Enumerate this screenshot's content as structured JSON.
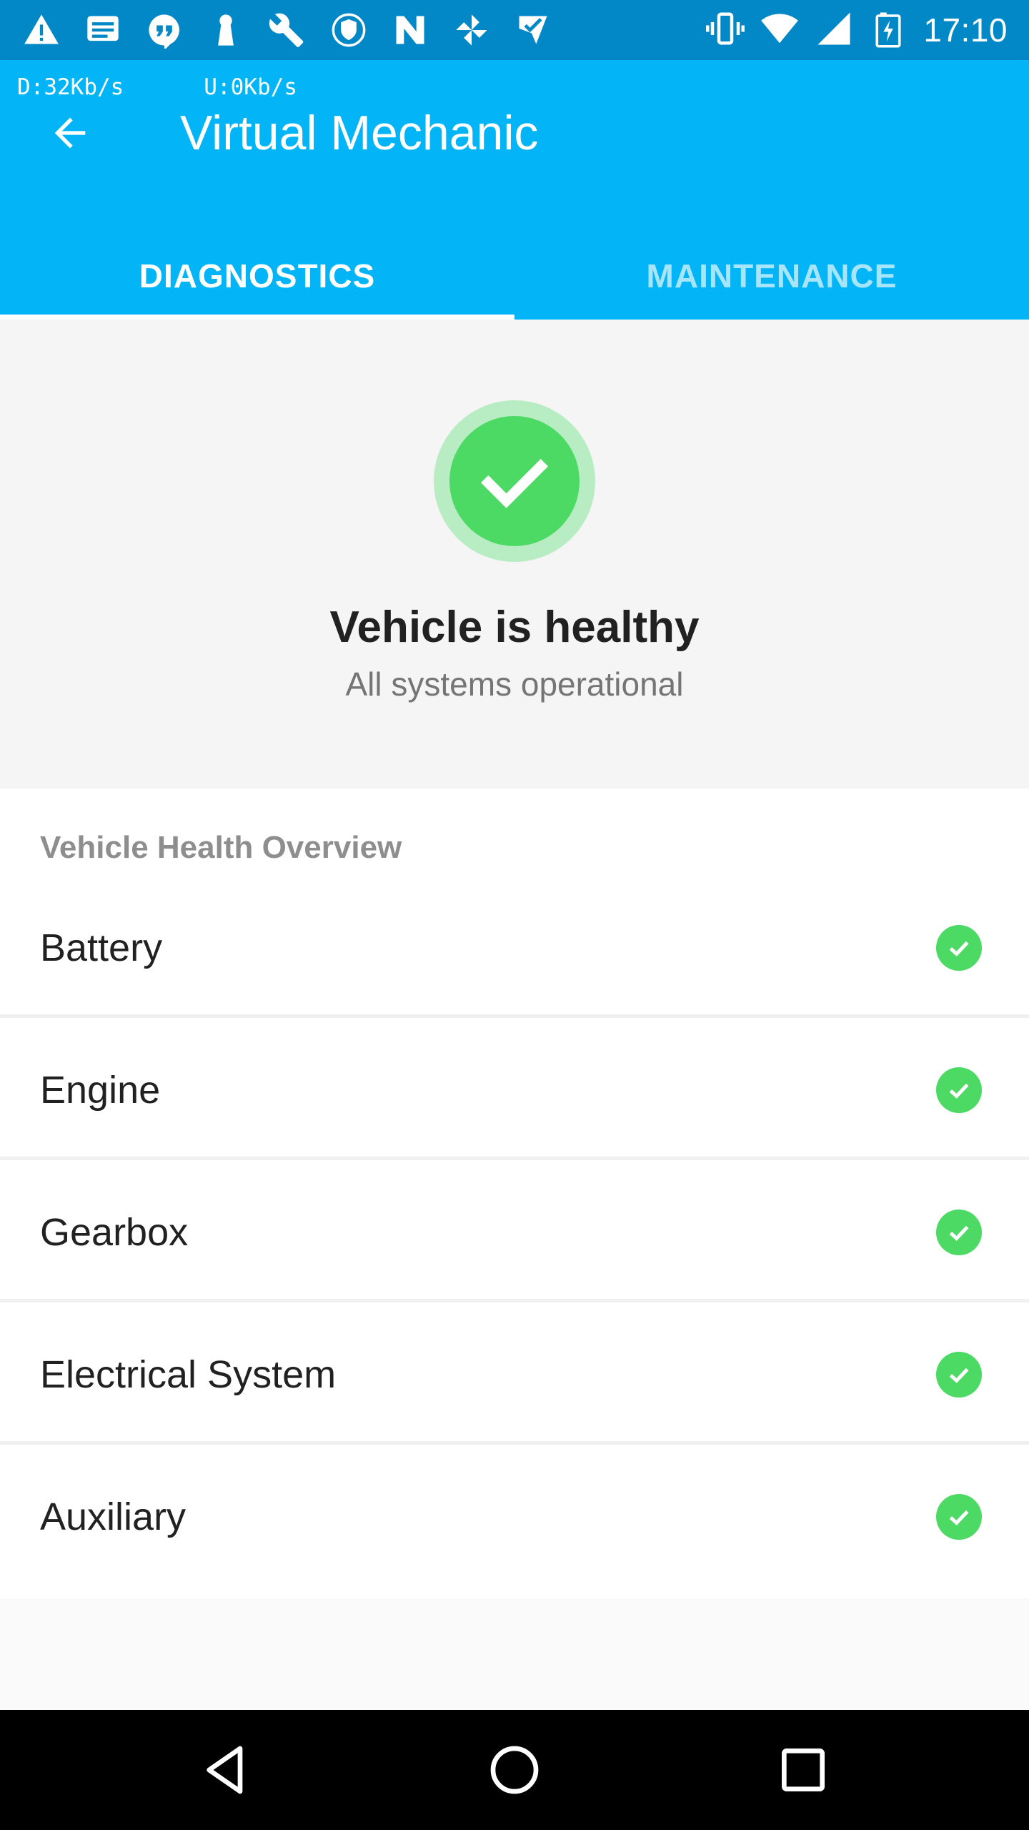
{
  "status_bar": {
    "time": "17:10",
    "left_icons": [
      "warning-icon",
      "message-icon",
      "quote-icon",
      "keyhole-icon",
      "wrench-icon",
      "shield-icon",
      "n-logo-icon",
      "pinwheel-icon",
      "check-badge-icon"
    ],
    "right_icons": [
      "vibrate-icon",
      "wifi-icon",
      "signal-icon",
      "battery-charging-icon"
    ]
  },
  "net_speed": {
    "download": "D:32Kb/s",
    "upload": "U:0Kb/s"
  },
  "app_bar": {
    "title": "Virtual Mechanic",
    "back_icon": "arrow-back-icon"
  },
  "tabs": [
    {
      "label": "DIAGNOSTICS",
      "active": true
    },
    {
      "label": "MAINTENANCE",
      "active": false
    }
  ],
  "health": {
    "title": "Vehicle is healthy",
    "subtitle": "All systems operational",
    "icon": "check-circle-icon"
  },
  "overview": {
    "header": "Vehicle Health Overview",
    "items": [
      {
        "label": "Battery",
        "status": "ok"
      },
      {
        "label": "Engine",
        "status": "ok"
      },
      {
        "label": "Gearbox",
        "status": "ok"
      },
      {
        "label": "Electrical System",
        "status": "ok"
      },
      {
        "label": "Auxiliary",
        "status": "ok"
      }
    ]
  },
  "nav_bar": {
    "buttons": [
      "back-triangle-icon",
      "home-circle-icon",
      "recents-square-icon"
    ]
  },
  "colors": {
    "status_bar": "#0288c7",
    "app_bar": "#03b5f6",
    "ok_green": "#4cd964",
    "ok_green_halo": "#b8ecc2"
  }
}
